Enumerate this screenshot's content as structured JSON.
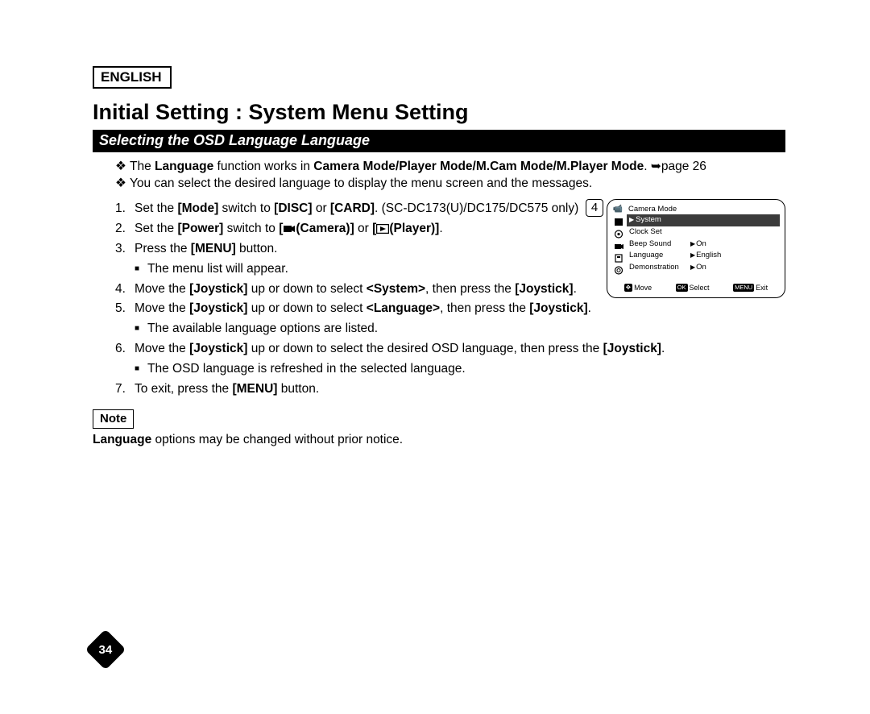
{
  "header": {
    "language_label": "ENGLISH",
    "main_title": "Initial Setting : System Menu Setting",
    "section_title": "Selecting the OSD Language Language"
  },
  "intro": {
    "line1_prefix": "The ",
    "line1_bold1": "Language",
    "line1_mid": " function works in ",
    "line1_bold2": "Camera Mode/Player Mode/M.Cam Mode/M.Player Mode",
    "line1_suffix": ". ➥page 26",
    "line2": "You can select the desired language to display the menu screen and the messages."
  },
  "steps": {
    "s1_a": "Set the ",
    "s1_b": "[Mode]",
    "s1_c": " switch to ",
    "s1_d": "[DISC]",
    "s1_e": " or ",
    "s1_f": "[CARD]",
    "s1_g": ". (SC-DC173(U)/DC175/DC575 only)",
    "s2_a": "Set the ",
    "s2_b": "[Power]",
    "s2_c": " switch to ",
    "s2_d": "[",
    "s2_cam": "(Camera)]",
    "s2_e": " or ",
    "s2_f": "[",
    "s2_play": "(Player)]",
    "s2_g": ".",
    "s3_a": "Press the ",
    "s3_b": "[MENU]",
    "s3_c": " button.",
    "s3_sub": "The menu list will appear.",
    "s4_a": "Move the ",
    "s4_b": "[Joystick]",
    "s4_c": " up or down to select ",
    "s4_d": "<System>",
    "s4_e": ", then press the ",
    "s4_f": "[Joystick]",
    "s4_g": ".",
    "s5_a": "Move the ",
    "s5_b": "[Joystick]",
    "s5_c": " up or down to select ",
    "s5_d": "<Language>",
    "s5_e": ", then press the ",
    "s5_f": "[Joystick]",
    "s5_g": ".",
    "s5_sub": "The available language options are listed.",
    "s6_a": "Move the ",
    "s6_b": "[Joystick]",
    "s6_c": " up or down to select the desired OSD language, then press the ",
    "s6_d": "[Joystick]",
    "s6_e": ".",
    "s6_sub": "The OSD language is refreshed in the selected language.",
    "s7_a": "To exit, press the ",
    "s7_b": "[MENU]",
    "s7_c": " button."
  },
  "note": {
    "label": "Note",
    "text_bold": "Language",
    "text_rest": " options may be changed without prior notice."
  },
  "osd": {
    "figure_number": "4",
    "title": "Camera Mode",
    "selected": "System",
    "rows": [
      {
        "label": "Clock Set",
        "value": ""
      },
      {
        "label": "Beep Sound",
        "value": "On"
      },
      {
        "label": "Language",
        "value": "English"
      },
      {
        "label": "Demonstration",
        "value": "On"
      }
    ],
    "footer": {
      "move": "Move",
      "select": "Select",
      "exit": "Exit"
    }
  },
  "page_number": "34"
}
